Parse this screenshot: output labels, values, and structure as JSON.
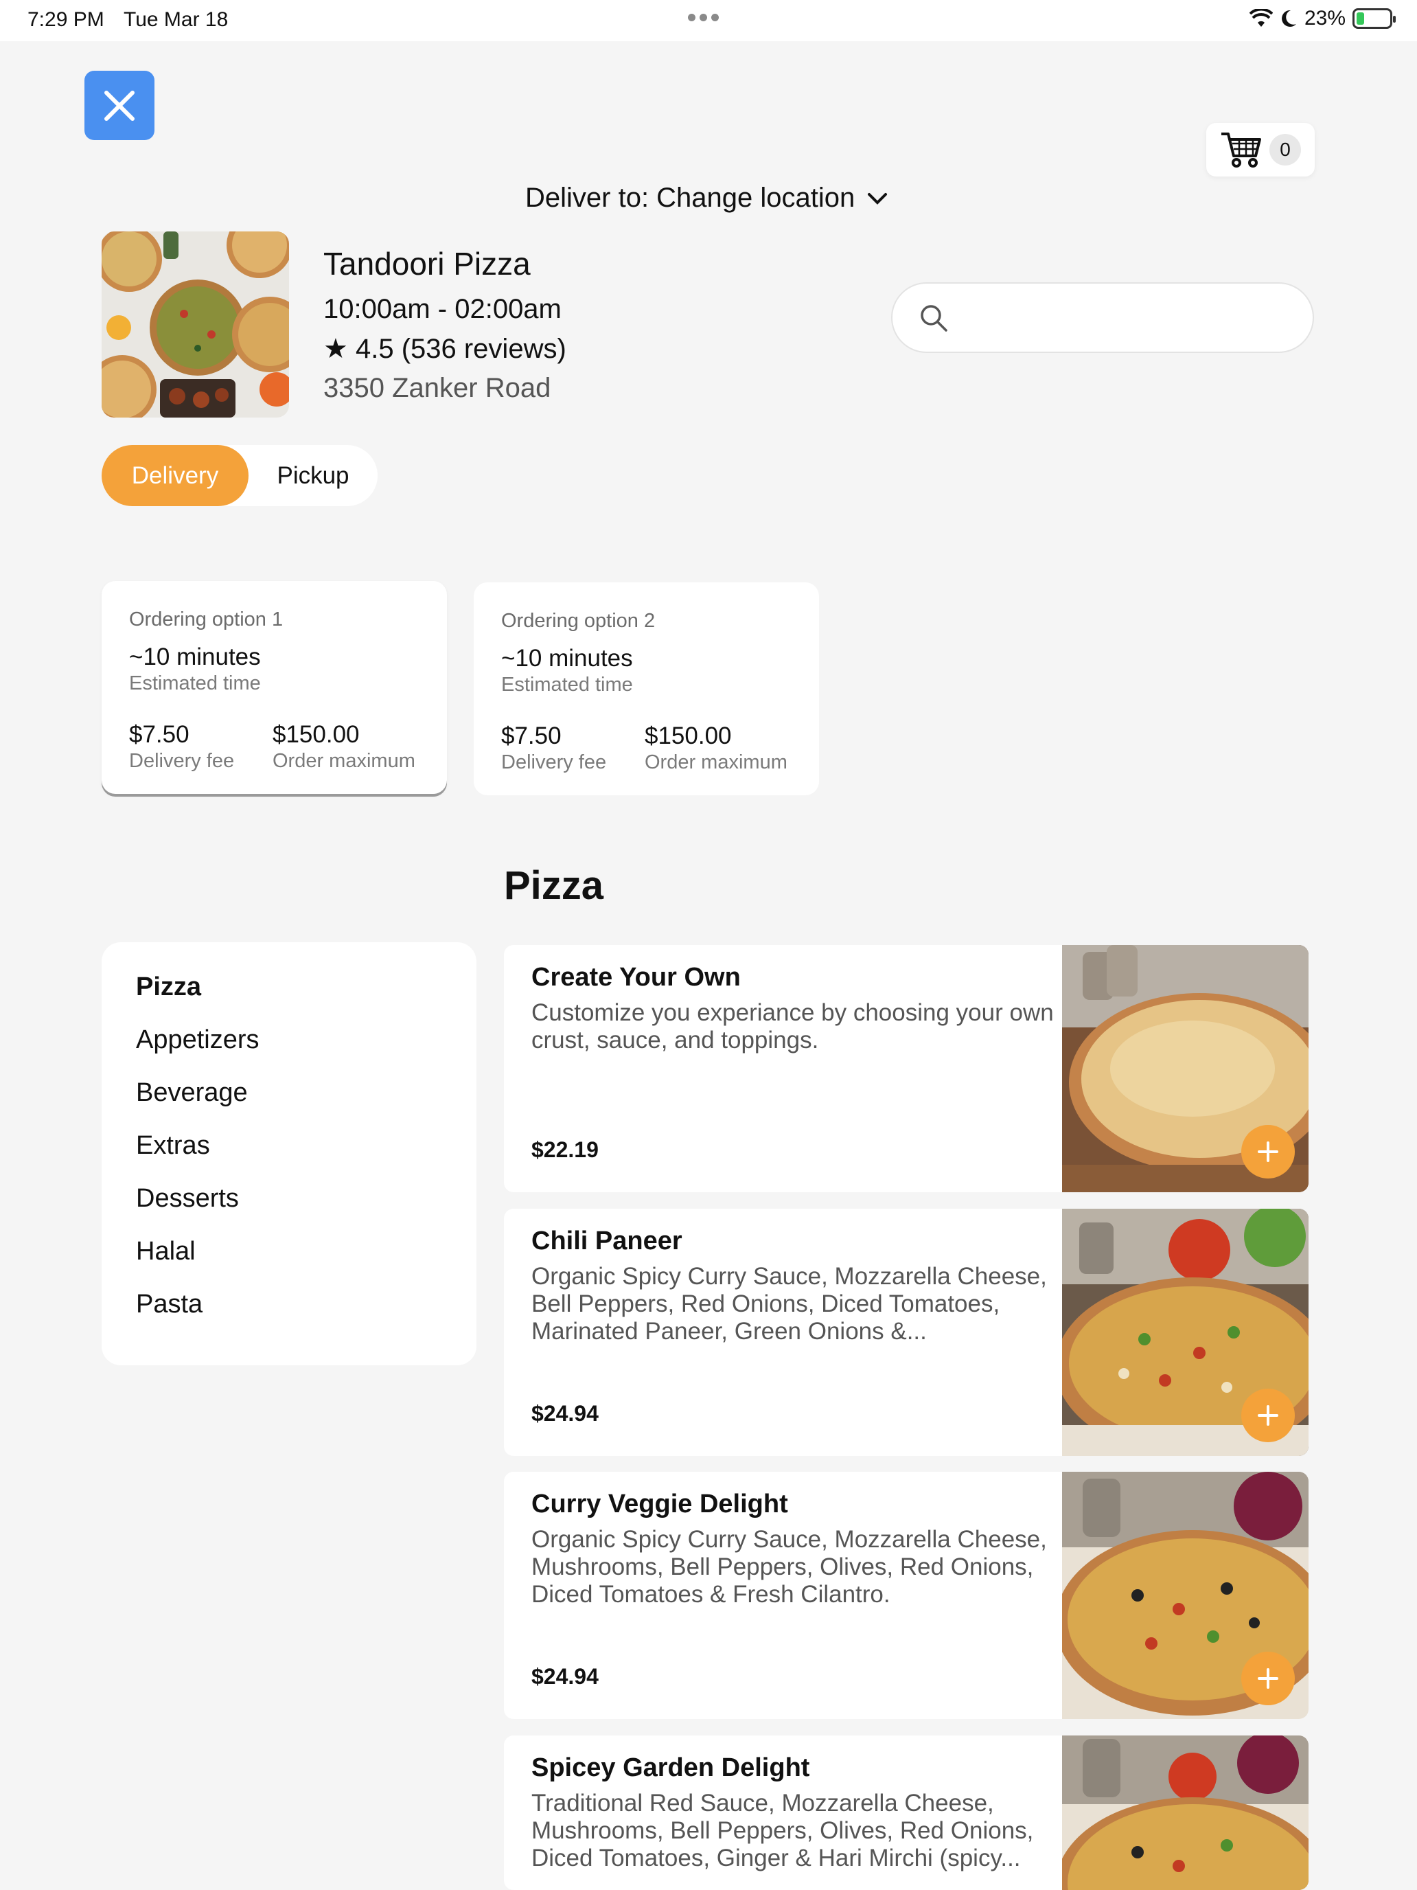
{
  "status_bar": {
    "time": "7:29 PM",
    "date": "Tue Mar 18",
    "battery": "23%",
    "battery_level": 0.23
  },
  "cart": {
    "count": "0"
  },
  "header": {
    "deliver_to": "Deliver to: Change location"
  },
  "store": {
    "name": "Tandoori Pizza",
    "hours": "10:00am - 02:00am",
    "rating": "★ 4.5 (536 reviews)",
    "address": "3350 Zanker Road"
  },
  "search": {
    "placeholder": ""
  },
  "mode": {
    "delivery": "Delivery",
    "pickup": "Pickup",
    "selected": "Delivery"
  },
  "ordering_options": [
    {
      "label": "Ordering option 1",
      "time": "~10 minutes",
      "time_sub": "Estimated time",
      "fee": "$7.50",
      "fee_sub": "Delivery fee",
      "max": "$150.00",
      "max_sub": "Order maximum"
    },
    {
      "label": "Ordering option 2",
      "time": "~10 minutes",
      "time_sub": "Estimated time",
      "fee": "$7.50",
      "fee_sub": "Delivery fee",
      "max": "$150.00",
      "max_sub": "Order maximum"
    }
  ],
  "section_title": "Pizza",
  "categories": [
    "Pizza",
    "Appetizers",
    "Beverage",
    "Extras",
    "Desserts",
    "Halal",
    "Pasta"
  ],
  "menu_items": [
    {
      "title": "Create Your Own",
      "desc": "Customize you experiance by choosing your own crust, sauce, and toppings.",
      "price": "$22.19"
    },
    {
      "title": "Chili Paneer",
      "desc": "Organic Spicy Curry Sauce, Mozzarella Cheese, Bell Peppers, Red Onions, Diced Tomatoes, Marinated Paneer, Green Onions &...",
      "price": "$24.94"
    },
    {
      "title": "Curry Veggie Delight",
      "desc": "Organic Spicy Curry Sauce, Mozzarella Cheese, Mushrooms, Bell Peppers, Olives, Red Onions, Diced Tomatoes & Fresh Cilantro.",
      "price": "$24.94"
    },
    {
      "title": "Spicey Garden Delight",
      "desc": "Traditional Red Sauce, Mozzarella Cheese, Mushrooms, Bell Peppers, Olives, Red Onions, Diced Tomatoes, Ginger & Hari Mirchi (spicy...",
      "price": ""
    }
  ],
  "colors": {
    "accent": "#f4a23a",
    "close_button": "#4a90f0",
    "background": "#f5f5f5"
  }
}
